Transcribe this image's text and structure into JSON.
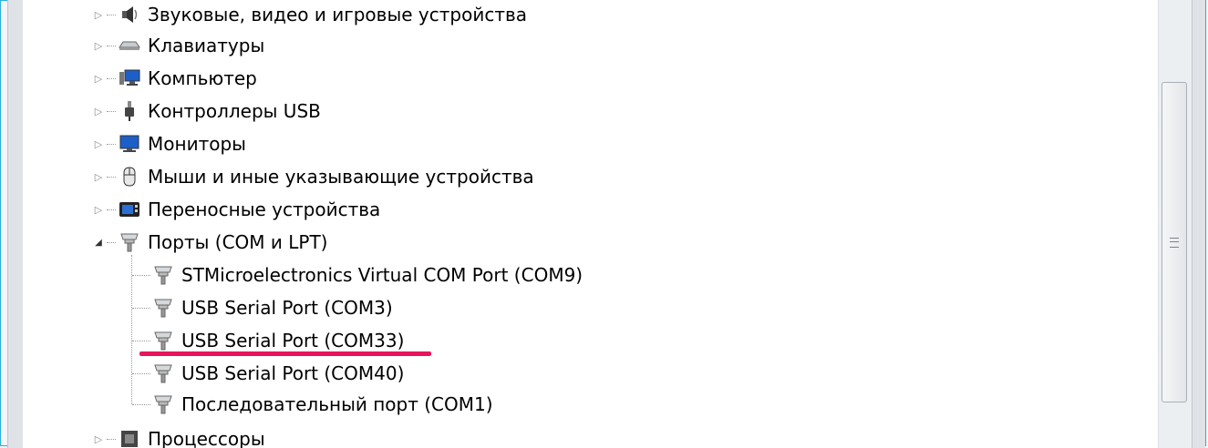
{
  "tree": {
    "categories": [
      {
        "label": "Звуковые, видео и игровые устройства",
        "icon": "speaker-icon",
        "expanded": false
      },
      {
        "label": "Клавиатуры",
        "icon": "keyboard-icon",
        "expanded": false
      },
      {
        "label": "Компьютер",
        "icon": "computer-icon",
        "expanded": false
      },
      {
        "label": "Контроллеры USB",
        "icon": "usb-plug-icon",
        "expanded": false
      },
      {
        "label": "Мониторы",
        "icon": "monitor-icon",
        "expanded": false
      },
      {
        "label": "Мыши и иные указывающие устройства",
        "icon": "mouse-icon",
        "expanded": false
      },
      {
        "label": "Переносные устройства",
        "icon": "portable-device-icon",
        "expanded": false
      },
      {
        "label": "Порты (COM и LPT)",
        "icon": "port-icon",
        "expanded": true
      },
      {
        "label": "Процессоры",
        "icon": "processor-icon",
        "expanded": false
      }
    ],
    "ports": [
      {
        "label": "STMicroelectronics Virtual COM Port (COM9)",
        "icon": "port-icon"
      },
      {
        "label": "USB Serial Port (COM3)",
        "icon": "port-icon"
      },
      {
        "label": "USB Serial Port (COM33)",
        "icon": "port-icon",
        "highlighted": true
      },
      {
        "label": "USB Serial Port (COM40)",
        "icon": "port-icon"
      },
      {
        "label": "Последовательный порт (COM1)",
        "icon": "port-icon"
      }
    ]
  },
  "colors": {
    "highlight": "#e8155d",
    "frame": "#29b0e0"
  }
}
